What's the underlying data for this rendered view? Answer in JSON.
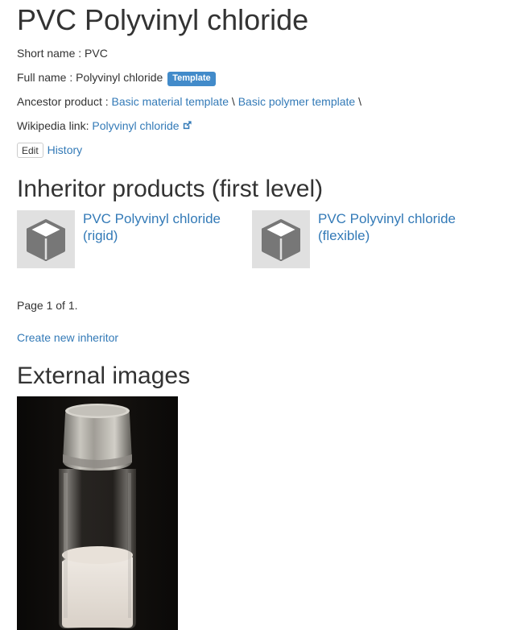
{
  "header": {
    "title": "PVC Polyvinyl chloride"
  },
  "details": {
    "short_name_label": "Short name : ",
    "short_name_value": "PVC",
    "full_name_label": "Full name : ",
    "full_name_value": "Polyvinyl chloride",
    "template_badge": "Template",
    "ancestor_label": "Ancestor product : ",
    "ancestors": [
      "Basic material template",
      "Basic polymer template"
    ],
    "ancestor_separator": " \\ ",
    "ancestor_trailing": " \\",
    "wikipedia_label": "Wikipedia link: ",
    "wikipedia_link": "Polyvinyl chloride"
  },
  "actions": {
    "edit_label": "Edit",
    "history_label": "History"
  },
  "inheritors": {
    "title": "Inheritor products (first level)",
    "items": [
      {
        "label": "PVC Polyvinyl chloride (rigid)",
        "icon": "cube-icon"
      },
      {
        "label": "PVC Polyvinyl chloride (flexible)",
        "icon": "cube-icon"
      }
    ],
    "pagination": "Page 1 of 1.",
    "create_label": "Create new inheritor"
  },
  "external_images": {
    "title": "External images",
    "photo_subject": "glass vial with white powder"
  },
  "colors": {
    "link": "#337ab7",
    "badge": "#428bca",
    "text": "#333333",
    "thumb_bg": "#e0e0e0"
  }
}
